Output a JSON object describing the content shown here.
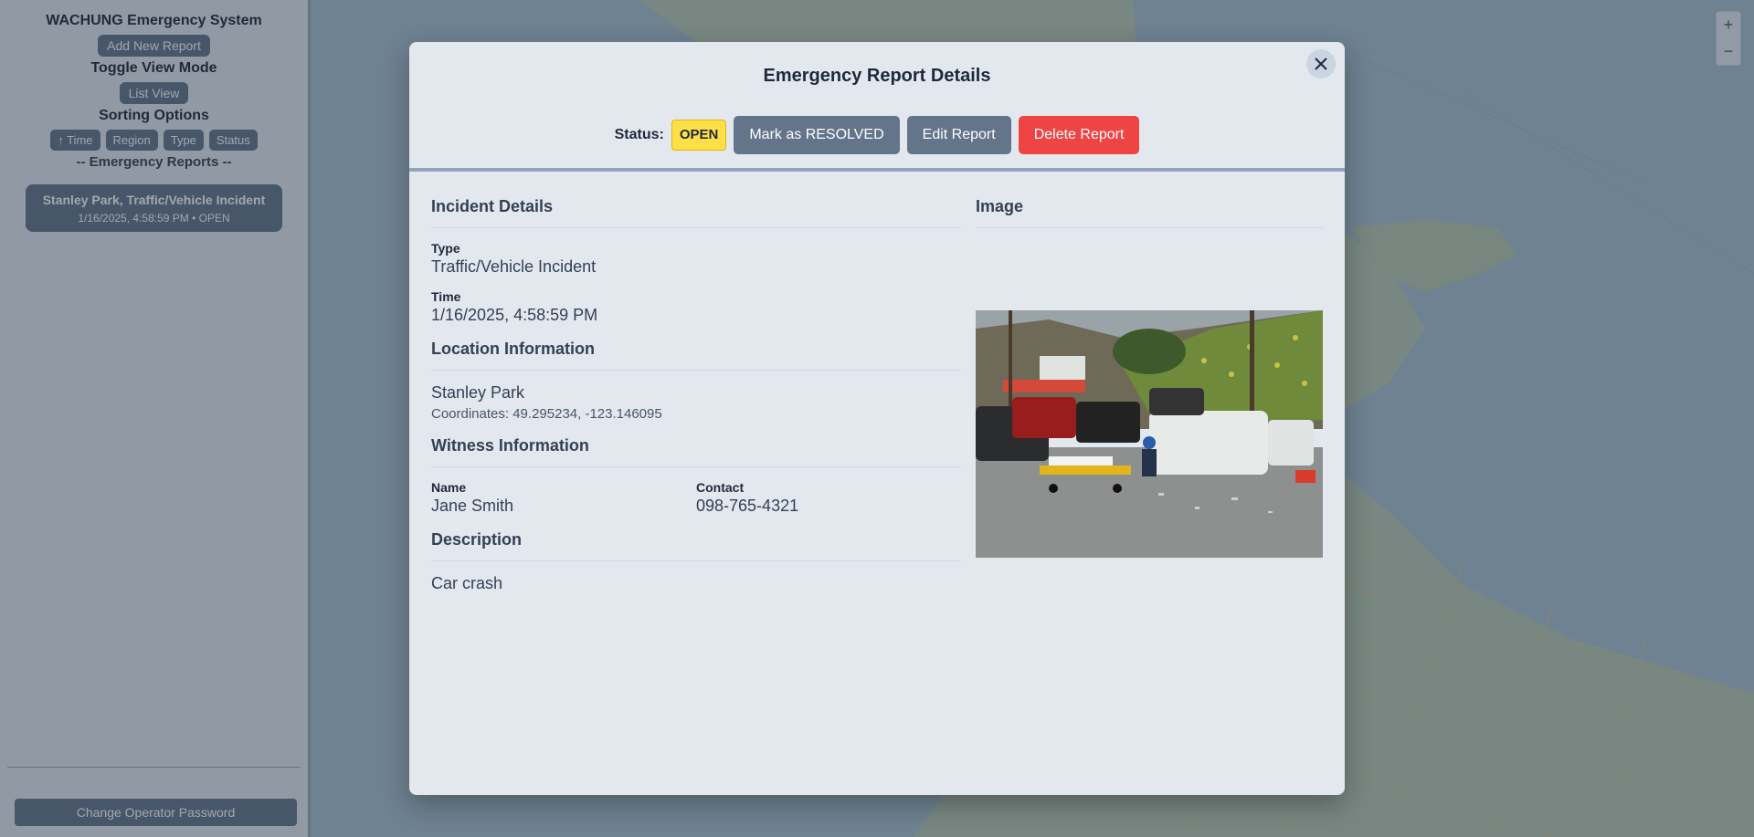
{
  "sidebar": {
    "title": "WACHUNG Emergency System",
    "create_label": "Add New Report",
    "toggle_label": "Toggle View Mode",
    "view_button": "List View",
    "sorting_label": "Sorting Options",
    "sort_buttons": [
      "↑ Time",
      "Region",
      "Type",
      "Status"
    ],
    "reports_header": "-- Emergency Reports --",
    "report_card": {
      "title": "Stanley Park, Traffic/Vehicle Incident",
      "subtitle": "1/16/2025, 4:58:59 PM • OPEN"
    },
    "bottom_button": "Change Operator Password"
  },
  "modal": {
    "title": "Emergency Report Details",
    "close_icon": "close-icon",
    "status_label": "Status:",
    "status_value": "OPEN",
    "buttons": {
      "resolve": "Mark as RESOLVED",
      "edit": "Edit Report",
      "delete": "Delete Report"
    },
    "incident": {
      "heading": "Incident Details",
      "type_label": "Type",
      "type_value": "Traffic/Vehicle Incident",
      "time_label": "Time",
      "time_value": "1/16/2025, 4:58:59 PM"
    },
    "location": {
      "heading": "Location Information",
      "name": "Stanley Park",
      "coordinates": "Coordinates: 49.295234, -123.146095"
    },
    "witness": {
      "heading": "Witness Information",
      "name_label": "Name",
      "name_value": "Jane Smith",
      "contact_label": "Contact",
      "contact_value": "098-765-4321"
    },
    "description": {
      "heading": "Description",
      "text": "Car crash"
    },
    "image": {
      "heading": "Image"
    }
  },
  "colors": {
    "status_open": "#fde047",
    "button_gray": "#64748b",
    "button_danger": "#ef4444",
    "modal_bg": "#e3e8ef"
  }
}
